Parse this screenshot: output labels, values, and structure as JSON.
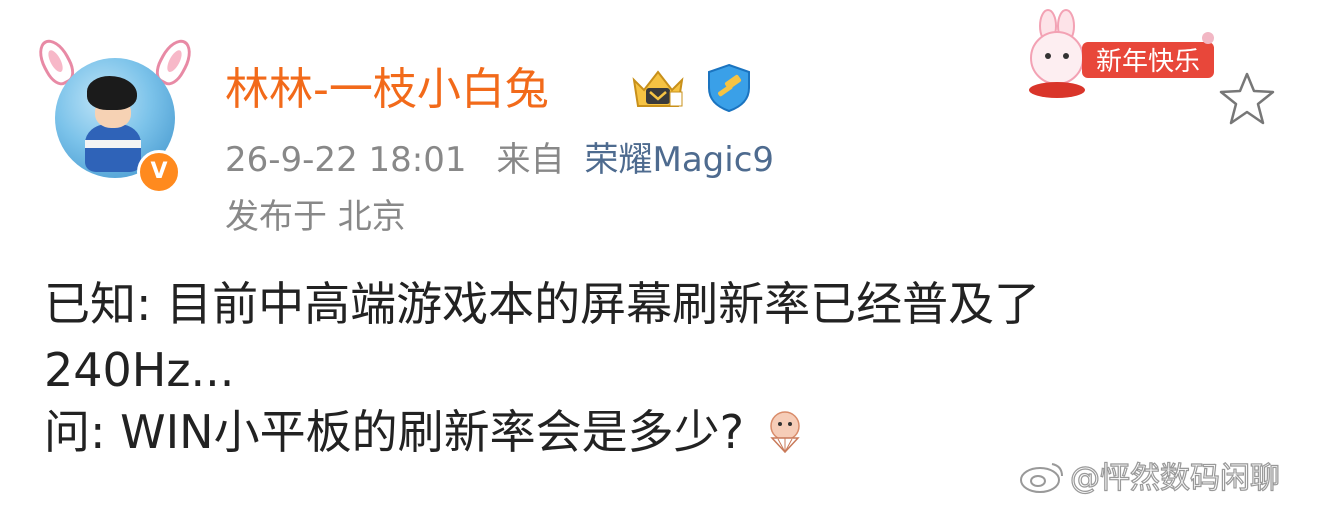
{
  "author": {
    "name": "林林-一枝小白兔",
    "verified_badge": "V",
    "name_color": "#f26a1a",
    "badge_color": "#ff8a1e"
  },
  "post_meta": {
    "timestamp": "26-9-22 18:01",
    "from_label": "来自",
    "source": "荣耀Magic9",
    "location": "发布于 北京",
    "source_color": "#4e6b8f"
  },
  "icons": {
    "avatar": "bunny-ears-avatar",
    "badges": [
      "crown-badge-icon",
      "shield-badge-icon"
    ],
    "sticker": "new-year-bunny-sticker",
    "favorite": "star-icon",
    "emoji": "fan-emoji-icon",
    "watermark_logo": "weibo-logo-icon"
  },
  "sticker": {
    "text": "新年快乐"
  },
  "content": {
    "line1": "已知: 目前中高端游戏本的屏幕刷新率已经普及了",
    "line2": "240Hz...",
    "line3": "问: WIN小平板的刷新率会是多少?"
  },
  "watermark": {
    "text": "@怦然数码闲聊"
  }
}
